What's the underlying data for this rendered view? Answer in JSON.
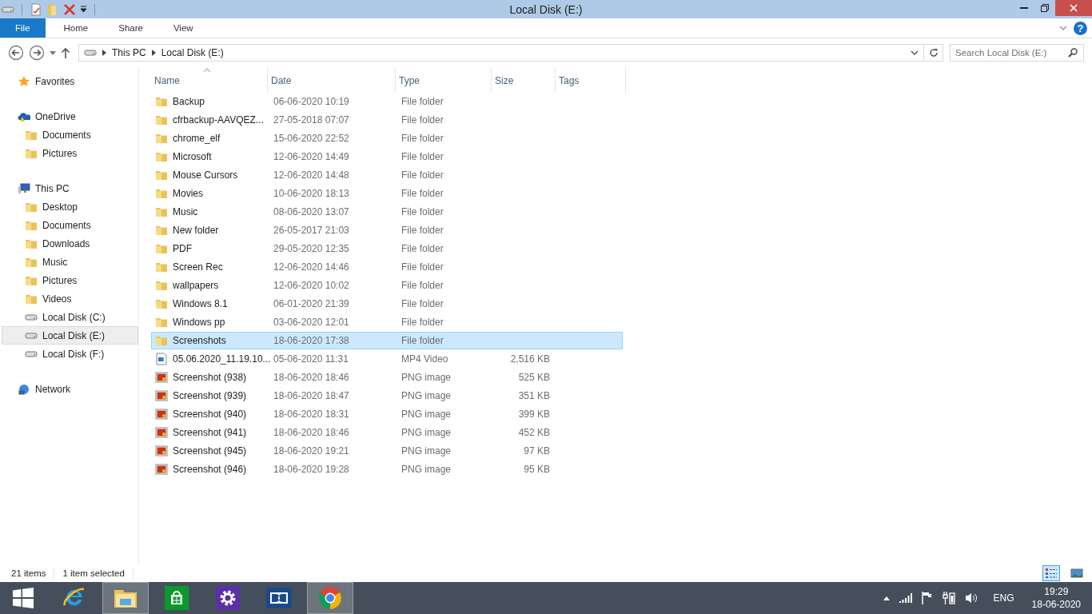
{
  "window": {
    "title": "Local Disk (E:)"
  },
  "ribbon": {
    "help": "?",
    "tabs": [
      {
        "label": "File",
        "selected": true
      },
      {
        "label": "Home",
        "selected": false
      },
      {
        "label": "Share",
        "selected": false
      },
      {
        "label": "View",
        "selected": false
      }
    ]
  },
  "address": {
    "crumbs": [
      "This PC",
      "Local Disk (E:)"
    ],
    "search_placeholder": "Search Local Disk (E:)"
  },
  "nav": [
    {
      "label": "Favorites",
      "kind": "star",
      "selected": false
    },
    {
      "label": "OneDrive",
      "kind": "cloud",
      "selected": false,
      "children": [
        {
          "label": "Documents",
          "kind": "folder",
          "selected": false
        },
        {
          "label": "Pictures",
          "kind": "folder",
          "selected": false
        }
      ]
    },
    {
      "label": "This PC",
      "kind": "pc",
      "selected": false,
      "children": [
        {
          "label": "Desktop",
          "kind": "folder",
          "selected": false
        },
        {
          "label": "Documents",
          "kind": "folder",
          "selected": false
        },
        {
          "label": "Downloads",
          "kind": "folder",
          "selected": false
        },
        {
          "label": "Music",
          "kind": "folder",
          "selected": false
        },
        {
          "label": "Pictures",
          "kind": "folder",
          "selected": false
        },
        {
          "label": "Videos",
          "kind": "folder",
          "selected": false
        },
        {
          "label": "Local Disk (C:)",
          "kind": "drive",
          "selected": false
        },
        {
          "label": "Local Disk (E:)",
          "kind": "drive",
          "selected": true
        },
        {
          "label": "Local Disk (F:)",
          "kind": "drive",
          "selected": false
        }
      ]
    },
    {
      "label": "Network",
      "kind": "network",
      "selected": false
    }
  ],
  "columns": [
    {
      "label": "Name",
      "sorted": true
    },
    {
      "label": "Date",
      "sorted": false
    },
    {
      "label": "Type",
      "sorted": false
    },
    {
      "label": "Size",
      "sorted": false
    },
    {
      "label": "Tags",
      "sorted": false
    }
  ],
  "files": [
    {
      "name": "Backup",
      "date": "06-06-2020 10:19",
      "type": "File folder",
      "kind": "folder",
      "selected": false
    },
    {
      "name": "cfrbackup-AAVQEZ...",
      "date": "27-05-2018 07:07",
      "type": "File folder",
      "kind": "folder",
      "selected": false
    },
    {
      "name": "chrome_elf",
      "date": "15-06-2020 22:52",
      "type": "File folder",
      "kind": "folder",
      "selected": false
    },
    {
      "name": "Microsoft",
      "date": "12-06-2020 14:49",
      "type": "File folder",
      "kind": "folder",
      "selected": false
    },
    {
      "name": "Mouse Cursors",
      "date": "12-06-2020 14:48",
      "type": "File folder",
      "kind": "folder",
      "selected": false
    },
    {
      "name": "Movies",
      "date": "10-06-2020 18:13",
      "type": "File folder",
      "kind": "folder",
      "selected": false
    },
    {
      "name": "Music",
      "date": "08-06-2020 13:07",
      "type": "File folder",
      "kind": "folder",
      "selected": false
    },
    {
      "name": "New folder",
      "date": "26-05-2017 21:03",
      "type": "File folder",
      "kind": "folder",
      "selected": false
    },
    {
      "name": "PDF",
      "date": "29-05-2020 12:35",
      "type": "File folder",
      "kind": "folder",
      "selected": false
    },
    {
      "name": "Screen Rec",
      "date": "12-06-2020 14:46",
      "type": "File folder",
      "kind": "folder",
      "selected": false
    },
    {
      "name": "wallpapers",
      "date": "12-06-2020 10:02",
      "type": "File folder",
      "kind": "folder",
      "selected": false
    },
    {
      "name": "Windows 8.1",
      "date": "06-01-2020 21:39",
      "type": "File folder",
      "kind": "folder",
      "selected": false
    },
    {
      "name": "Windows pp",
      "date": "03-06-2020 12:01",
      "type": "File folder",
      "kind": "folder",
      "selected": false
    },
    {
      "name": "Screenshots",
      "date": "18-06-2020 17:38",
      "type": "File folder",
      "kind": "folder",
      "selected": true
    },
    {
      "name": "05.06.2020_11.19.10...",
      "date": "05-06-2020 11:31",
      "type": "MP4 Video",
      "size": "2,516 KB",
      "kind": "video",
      "selected": false
    },
    {
      "name": "Screenshot (938)",
      "date": "18-06-2020 18:46",
      "type": "PNG image",
      "size": "525 KB",
      "kind": "image",
      "selected": false
    },
    {
      "name": "Screenshot (939)",
      "date": "18-06-2020 18:47",
      "type": "PNG image",
      "size": "351 KB",
      "kind": "image",
      "selected": false
    },
    {
      "name": "Screenshot (940)",
      "date": "18-06-2020 18:31",
      "type": "PNG image",
      "size": "399 KB",
      "kind": "image",
      "selected": false
    },
    {
      "name": "Screenshot (941)",
      "date": "18-06-2020 18:46",
      "type": "PNG image",
      "size": "452 KB",
      "kind": "image",
      "selected": false
    },
    {
      "name": "Screenshot (945)",
      "date": "18-06-2020 19:21",
      "type": "PNG image",
      "size": "97 KB",
      "kind": "image",
      "selected": false
    },
    {
      "name": "Screenshot (946)",
      "date": "18-06-2020 19:28",
      "type": "PNG image",
      "size": "95 KB",
      "kind": "image",
      "selected": false
    }
  ],
  "status_bar": {
    "count": "21 items",
    "selection": "1 item selected",
    "views": [
      {
        "kind": "details",
        "selected": true
      },
      {
        "kind": "thumbnails",
        "selected": false
      }
    ]
  },
  "taskbar": {
    "apps": [
      {
        "kind": "start",
        "active": false
      },
      {
        "kind": "browser",
        "active": false
      },
      {
        "kind": "explorer",
        "active": true
      },
      {
        "kind": "store",
        "active": false
      },
      {
        "kind": "settings",
        "active": false
      },
      {
        "kind": "dolby",
        "active": false
      },
      {
        "kind": "chrome",
        "active": true
      }
    ],
    "language": "ENG",
    "time": "19:29",
    "date": "18-06-2020"
  }
}
